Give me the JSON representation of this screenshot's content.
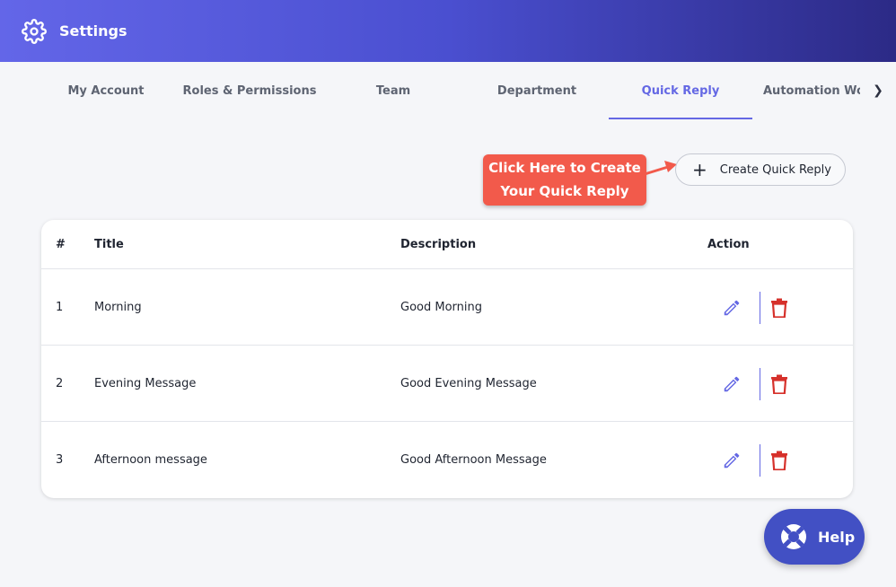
{
  "header": {
    "title": "Settings",
    "icon": "gear-icon"
  },
  "tabs": [
    {
      "label": "My Account"
    },
    {
      "label": "Roles & Permissions"
    },
    {
      "label": "Team"
    },
    {
      "label": "Department"
    },
    {
      "label": "Quick Reply",
      "active": true
    },
    {
      "label": "Automation Workflow"
    }
  ],
  "callout": {
    "line1": "Click Here to Create",
    "line2": "Your Quick Reply"
  },
  "create_button": {
    "label": "Create Quick Reply",
    "icon": "plus-icon"
  },
  "table": {
    "headers": {
      "num": "#",
      "title": "Title",
      "description": "Description",
      "action": "Action"
    },
    "rows": [
      {
        "num": "1",
        "title": "Morning",
        "description": "Good Morning"
      },
      {
        "num": "2",
        "title": "Evening Message",
        "description": "Good Evening Message"
      },
      {
        "num": "3",
        "title": "Afternoon message",
        "description": "Good Afternoon Message"
      }
    ]
  },
  "help_button": {
    "label": "Help",
    "icon": "lifebuoy-icon"
  },
  "colors": {
    "accent": "#6468e4",
    "danger": "#d6312b",
    "callout": "#f25a4b",
    "help": "#4250c4"
  }
}
